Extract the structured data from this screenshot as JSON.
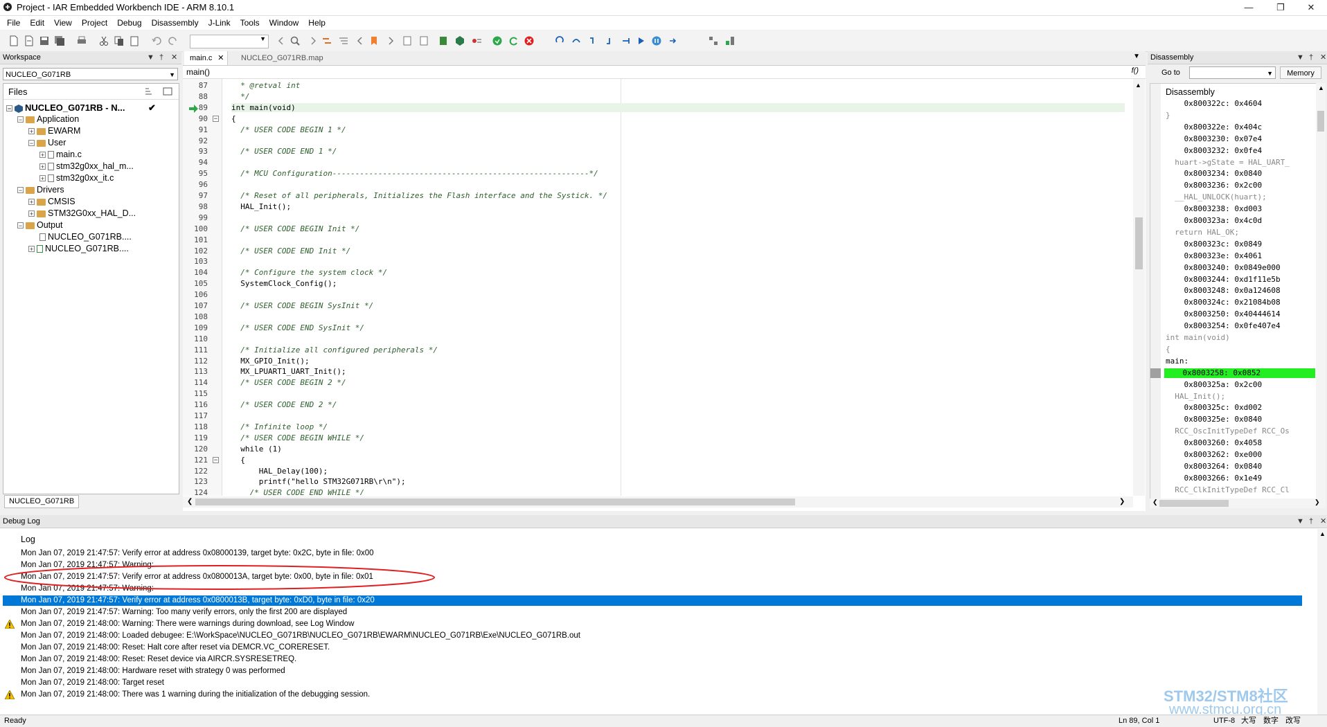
{
  "window": {
    "title": "Project - IAR Embedded Workbench IDE - ARM 8.10.1"
  },
  "menu": [
    "File",
    "Edit",
    "View",
    "Project",
    "Debug",
    "Disassembly",
    "J-Link",
    "Tools",
    "Window",
    "Help"
  ],
  "workspace": {
    "title": "Workspace",
    "config": "NUCLEO_G071RB",
    "files_header": "Files",
    "bottom_tab": "NUCLEO_G071RB",
    "tree": [
      "NUCLEO_G071RB - N...",
      "Application",
      "EWARM",
      "User",
      "main.c",
      "stm32g0xx_hal_m...",
      "stm32g0xx_it.c",
      "Drivers",
      "CMSIS",
      "STM32G0xx_HAL_D...",
      "Output",
      "NUCLEO_G071RB....",
      "NUCLEO_G071RB...."
    ]
  },
  "editor": {
    "tabs": [
      "main.c",
      "NUCLEO_G071RB.map"
    ],
    "function": "main()",
    "lines": [
      {
        "n": "87",
        "t": "  * @retval int"
      },
      {
        "n": "88",
        "t": "  */"
      },
      {
        "n": "89",
        "t": "int main(void)"
      },
      {
        "n": "90",
        "t": "{"
      },
      {
        "n": "91",
        "t": "  /* USER CODE BEGIN 1 */"
      },
      {
        "n": "92",
        "t": ""
      },
      {
        "n": "93",
        "t": "  /* USER CODE END 1 */"
      },
      {
        "n": "94",
        "t": ""
      },
      {
        "n": "95",
        "t": "  /* MCU Configuration--------------------------------------------------------*/"
      },
      {
        "n": "96",
        "t": ""
      },
      {
        "n": "97",
        "t": "  /* Reset of all peripherals, Initializes the Flash interface and the Systick. */"
      },
      {
        "n": "98",
        "t": "  HAL_Init();"
      },
      {
        "n": "99",
        "t": ""
      },
      {
        "n": "100",
        "t": "  /* USER CODE BEGIN Init */"
      },
      {
        "n": "101",
        "t": ""
      },
      {
        "n": "102",
        "t": "  /* USER CODE END Init */"
      },
      {
        "n": "103",
        "t": ""
      },
      {
        "n": "104",
        "t": "  /* Configure the system clock */"
      },
      {
        "n": "105",
        "t": "  SystemClock_Config();"
      },
      {
        "n": "106",
        "t": ""
      },
      {
        "n": "107",
        "t": "  /* USER CODE BEGIN SysInit */"
      },
      {
        "n": "108",
        "t": ""
      },
      {
        "n": "109",
        "t": "  /* USER CODE END SysInit */"
      },
      {
        "n": "110",
        "t": ""
      },
      {
        "n": "111",
        "t": "  /* Initialize all configured peripherals */"
      },
      {
        "n": "112",
        "t": "  MX_GPIO_Init();"
      },
      {
        "n": "113",
        "t": "  MX_LPUART1_UART_Init();"
      },
      {
        "n": "114",
        "t": "  /* USER CODE BEGIN 2 */"
      },
      {
        "n": "115",
        "t": ""
      },
      {
        "n": "116",
        "t": "  /* USER CODE END 2 */"
      },
      {
        "n": "117",
        "t": ""
      },
      {
        "n": "118",
        "t": "  /* Infinite loop */"
      },
      {
        "n": "119",
        "t": "  /* USER CODE BEGIN WHILE */"
      },
      {
        "n": "120",
        "t": "  while (1)"
      },
      {
        "n": "121",
        "t": "  {"
      },
      {
        "n": "122",
        "t": "      HAL_Delay(100);"
      },
      {
        "n": "123",
        "t": "      printf(\"hello STM32G071RB\\r\\n\");"
      },
      {
        "n": "124",
        "t": "    /* USER CODE END WHILE */"
      }
    ]
  },
  "disassembly": {
    "title": "Disassembly",
    "goto_label": "Go to",
    "memory_button": "Memory",
    "header": "Disassembly",
    "lines": [
      {
        "t": "    0x800322c: 0x4604",
        "k": "addr"
      },
      {
        "t": "}",
        "k": "src"
      },
      {
        "t": "    0x800322e: 0x404c",
        "k": "addr"
      },
      {
        "t": "    0x8003230: 0x07e4",
        "k": "addr"
      },
      {
        "t": "    0x8003232: 0x0fe4",
        "k": "addr"
      },
      {
        "t": "  huart->gState = HAL_UART_",
        "k": "src"
      },
      {
        "t": "    0x8003234: 0x0840",
        "k": "addr"
      },
      {
        "t": "    0x8003236: 0x2c00",
        "k": "addr"
      },
      {
        "t": "  __HAL_UNLOCK(huart);",
        "k": "src"
      },
      {
        "t": "    0x8003238: 0xd003",
        "k": "addr"
      },
      {
        "t": "    0x800323a: 0x4c0d",
        "k": "addr"
      },
      {
        "t": "  return HAL_OK;",
        "k": "src"
      },
      {
        "t": "    0x800323c: 0x0849",
        "k": "addr"
      },
      {
        "t": "    0x800323e: 0x4061",
        "k": "addr"
      },
      {
        "t": "    0x8003240: 0x0849e000",
        "k": "addr"
      },
      {
        "t": "    0x8003244: 0xd1f11e5b",
        "k": "addr"
      },
      {
        "t": "    0x8003248: 0x0a124608",
        "k": "addr"
      },
      {
        "t": "    0x800324c: 0x21084b08",
        "k": "addr"
      },
      {
        "t": "    0x8003250: 0x40444614",
        "k": "addr"
      },
      {
        "t": "    0x8003254: 0x0fe407e4",
        "k": "addr"
      },
      {
        "t": "int main(void)",
        "k": "src"
      },
      {
        "t": "{",
        "k": "src"
      },
      {
        "t": "main:",
        "k": "label"
      },
      {
        "t": "    0x8003258: 0x0852",
        "k": "cur"
      },
      {
        "t": "    0x800325a: 0x2c00",
        "k": "addr"
      },
      {
        "t": "  HAL_Init();",
        "k": "src"
      },
      {
        "t": "    0x800325c: 0xd002",
        "k": "addr"
      },
      {
        "t": "    0x800325e: 0x0840",
        "k": "addr"
      },
      {
        "t": "  RCC_OscInitTypeDef RCC_Os",
        "k": "src"
      },
      {
        "t": "    0x8003260: 0x4058",
        "k": "addr"
      },
      {
        "t": "    0x8003262: 0xe000",
        "k": "addr"
      },
      {
        "t": "    0x8003264: 0x0840",
        "k": "addr"
      },
      {
        "t": "    0x8003266: 0x1e49",
        "k": "addr"
      },
      {
        "t": "  RCC_ClkInitTypeDef RCC_Cl",
        "k": "src"
      }
    ]
  },
  "debuglog": {
    "title": "Debug Log",
    "header": "Log",
    "lines": [
      {
        "t": "Mon Jan 07, 2019 21:47:57: Verify error at address 0x08000139, target byte: 0x2C, byte in file: 0x00",
        "w": false,
        "sel": false
      },
      {
        "t": "Mon Jan 07, 2019 21:47:57: Warning:",
        "w": false,
        "sel": false
      },
      {
        "t": "Mon Jan 07, 2019 21:47:57: Verify error at address 0x0800013A, target byte: 0x00, byte in file: 0x01",
        "w": false,
        "sel": false
      },
      {
        "t": "Mon Jan 07, 2019 21:47:57: Warning:",
        "w": false,
        "sel": false
      },
      {
        "t": "Mon Jan 07, 2019 21:47:57: Verify error at address 0x0800013B, target byte: 0xD0, byte in file: 0x20",
        "w": false,
        "sel": true
      },
      {
        "t": "Mon Jan 07, 2019 21:47:57: Warning: Too many verify errors, only the first 200 are displayed",
        "w": false,
        "sel": false
      },
      {
        "t": "Mon Jan 07, 2019 21:48:00: Warning: There were warnings during download, see Log Window",
        "w": true,
        "sel": false
      },
      {
        "t": "Mon Jan 07, 2019 21:48:00: Loaded debugee: E:\\WorkSpace\\NUCLEO_G071RB\\NUCLEO_G071RB\\EWARM\\NUCLEO_G071RB\\Exe\\NUCLEO_G071RB.out",
        "w": false,
        "sel": false
      },
      {
        "t": "Mon Jan 07, 2019 21:48:00: Reset: Halt core after reset via DEMCR.VC_CORERESET.",
        "w": false,
        "sel": false
      },
      {
        "t": "Mon Jan 07, 2019 21:48:00: Reset: Reset device via AIRCR.SYSRESETREQ.",
        "w": false,
        "sel": false
      },
      {
        "t": "Mon Jan 07, 2019 21:48:00: Hardware reset with strategy 0 was performed",
        "w": false,
        "sel": false
      },
      {
        "t": "Mon Jan 07, 2019 21:48:00: Target reset",
        "w": false,
        "sel": false
      },
      {
        "t": "Mon Jan 07, 2019 21:48:00: There was 1 warning during the initialization of the debugging session.",
        "w": true,
        "sel": false
      }
    ]
  },
  "status": {
    "left": "Ready",
    "position": "Ln 89, Col 1",
    "encoding": "UTF-8",
    "ime": [
      "大写",
      "数字",
      "改写"
    ]
  },
  "watermark": {
    "line1": "STM32/STM8社区",
    "line2": "www.stmcu.org.cn"
  },
  "colors": {
    "selection": "#0078d7",
    "current_instr": "#22ee22",
    "title_accent": "#ffffff"
  }
}
